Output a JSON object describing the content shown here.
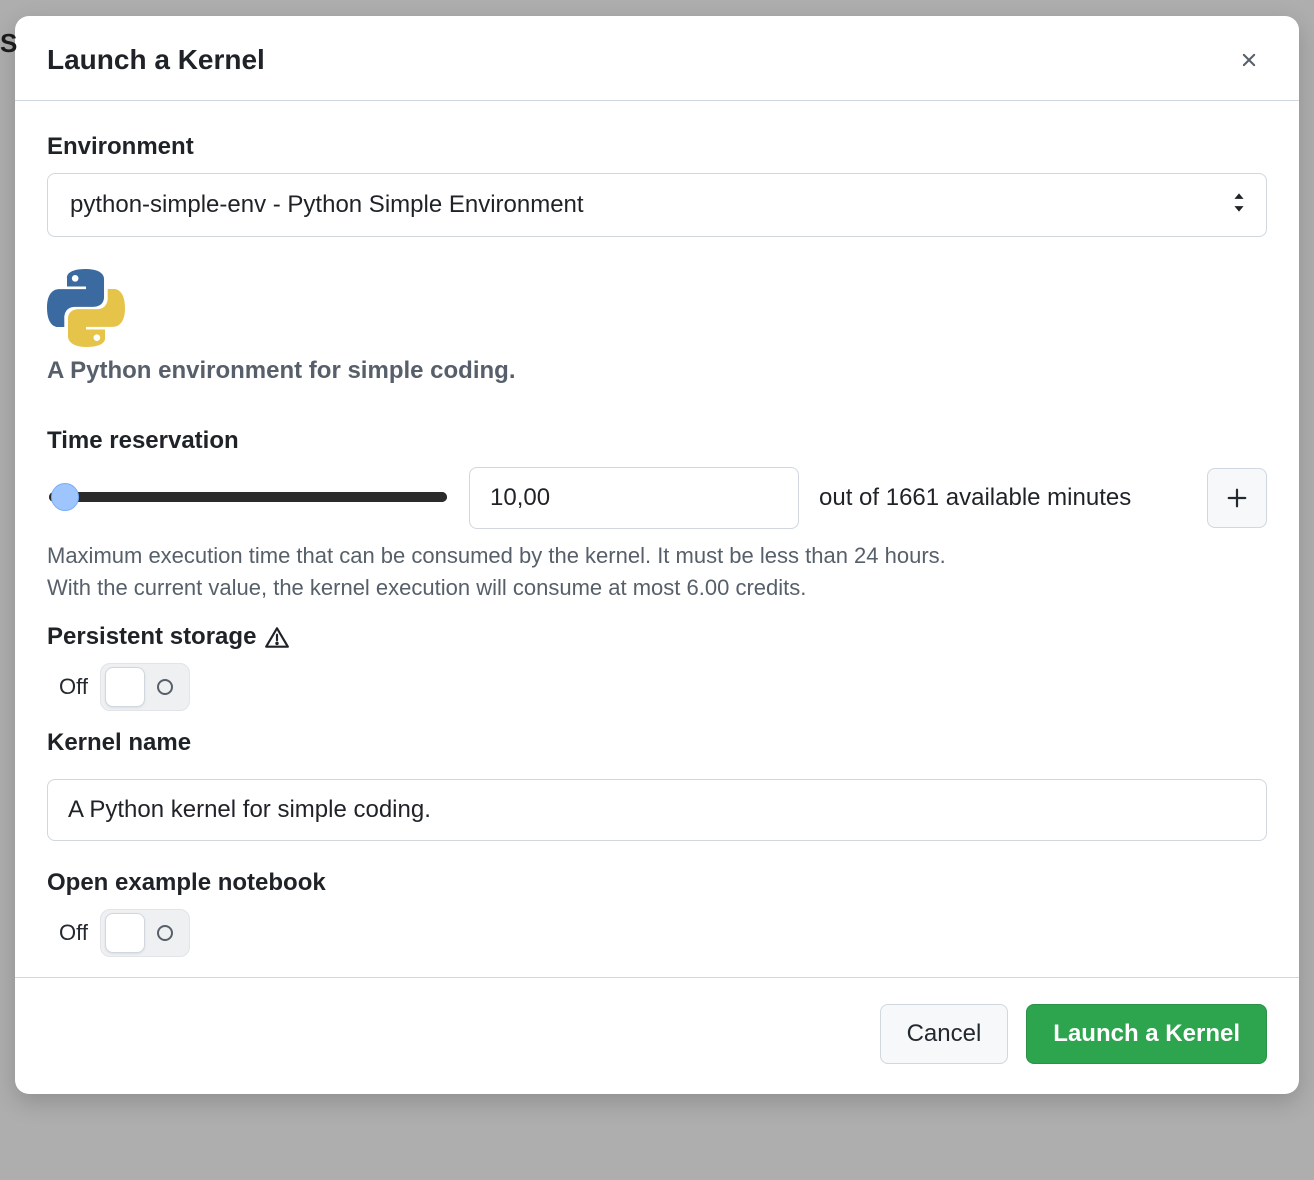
{
  "modal": {
    "title": "Launch a Kernel",
    "environment": {
      "label": "Environment",
      "selected": "python-simple-env - Python Simple Environment",
      "logo_name": "python-icon",
      "description": "A Python environment for simple coding."
    },
    "time_reservation": {
      "label": "Time reservation",
      "value": "10,00",
      "available_text": "out of 1661 available minutes",
      "help_line_1": "Maximum execution time that can be consumed by the kernel. It must be less than 24 hours.",
      "help_line_2": "With the current value, the kernel execution will consume at most 6.00 credits."
    },
    "persistent_storage": {
      "label": "Persistent storage",
      "state_label": "Off",
      "state": false
    },
    "kernel_name": {
      "label": "Kernel name",
      "value": "A Python kernel for simple coding."
    },
    "open_example_notebook": {
      "label": "Open example notebook",
      "state_label": "Off",
      "state": false
    },
    "footer": {
      "cancel_label": "Cancel",
      "launch_label": "Launch a Kernel"
    }
  }
}
